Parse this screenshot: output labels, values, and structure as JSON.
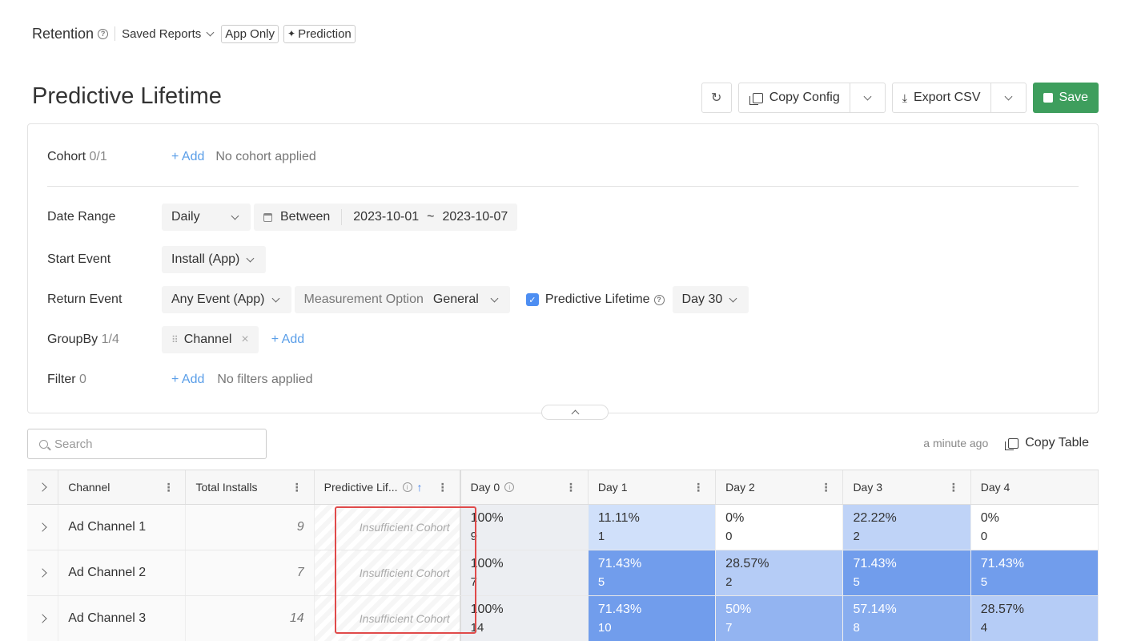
{
  "topbar": {
    "title": "Retention",
    "saved_reports": "Saved Reports",
    "app_only": "App Only",
    "prediction": "Prediction"
  },
  "header": {
    "title": "Predictive Lifetime",
    "copy_config": "Copy Config",
    "export_csv": "Export CSV",
    "save": "Save"
  },
  "config": {
    "cohort": {
      "label": "Cohort",
      "count": "0/1",
      "add": "+ Add",
      "empty": "No cohort applied"
    },
    "date_range": {
      "label": "Date Range",
      "granularity": "Daily",
      "mode": "Between",
      "start": "2023-10-01",
      "tilde": "~",
      "end": "2023-10-07"
    },
    "start_event": {
      "label": "Start Event",
      "value": "Install (App)"
    },
    "return_event": {
      "label": "Return Event",
      "value": "Any Event (App)",
      "measurement_label": "Measurement Option",
      "measurement_value": "General",
      "predictive_label": "Predictive Lifetime",
      "predictive_day": "Day 30"
    },
    "groupby": {
      "label": "GroupBy",
      "count": "1/4",
      "chip": "Channel",
      "add": "+ Add"
    },
    "filter": {
      "label": "Filter",
      "count": "0",
      "add": "+ Add",
      "empty": "No filters applied"
    }
  },
  "search": {
    "placeholder": "Search"
  },
  "table_meta": {
    "updated": "a minute ago",
    "copy_table": "Copy Table"
  },
  "table": {
    "columns": [
      "Channel",
      "Total Installs",
      "Predictive Lif...",
      "Day 0",
      "Day 1",
      "Day 2",
      "Day 3",
      "Day 4"
    ],
    "rows": [
      {
        "channel": "Ad Channel 1",
        "installs": "9",
        "predictive": "Insufficient Cohort",
        "days": [
          {
            "pct": "100%",
            "n": "9"
          },
          {
            "pct": "11.11%",
            "n": "1"
          },
          {
            "pct": "0%",
            "n": "0"
          },
          {
            "pct": "22.22%",
            "n": "2"
          },
          {
            "pct": "0%",
            "n": "0"
          }
        ]
      },
      {
        "channel": "Ad Channel 2",
        "installs": "7",
        "predictive": "Insufficient Cohort",
        "days": [
          {
            "pct": "100%",
            "n": "7"
          },
          {
            "pct": "71.43%",
            "n": "5"
          },
          {
            "pct": "28.57%",
            "n": "2"
          },
          {
            "pct": "71.43%",
            "n": "5"
          },
          {
            "pct": "71.43%",
            "n": "5"
          }
        ]
      },
      {
        "channel": "Ad Channel 3",
        "installs": "14",
        "predictive": "Insufficient Cohort",
        "days": [
          {
            "pct": "100%",
            "n": "14"
          },
          {
            "pct": "71.43%",
            "n": "10"
          },
          {
            "pct": "50%",
            "n": "7"
          },
          {
            "pct": "57.14%",
            "n": "8"
          },
          {
            "pct": "28.57%",
            "n": "4"
          }
        ]
      }
    ]
  },
  "colors": {
    "accent": "#4d8ef2",
    "save": "#3e9e5d",
    "link": "#5a9ee8",
    "highlight": "#e04a4a"
  }
}
